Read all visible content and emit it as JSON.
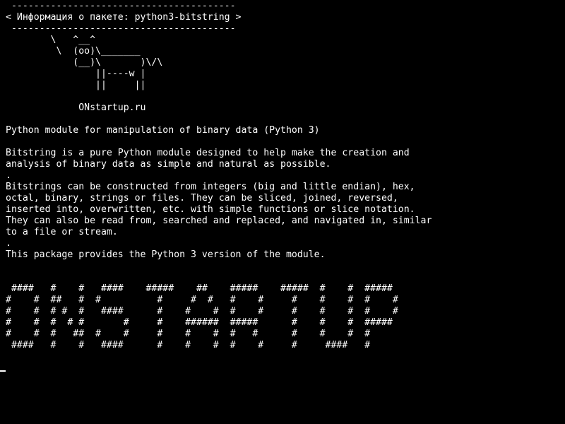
{
  "theme": {
    "background": "#000000",
    "foreground": "#ffffff"
  },
  "terminal": {
    "lines": [
      " ----------------------------------------",
      "< Информация о пакете: python3-bitstring >",
      " ----------------------------------------",
      "        \\   ^__^",
      "         \\  (oo)\\_______",
      "            (__)\\       )\\/\\",
      "                ||----w |",
      "                ||     ||",
      "",
      "             ONstartup.ru",
      "",
      "Python module for manipulation of binary data (Python 3)",
      "",
      "Bitstring is a pure Python module designed to help make the creation and",
      "analysis of binary data as simple and natural as possible.",
      ".",
      "Bitstrings can be constructed from integers (big and little endian), hex,",
      "octal, binary, strings or files. They can be sliced, joined, reversed,",
      "inserted into, overwritten, etc. with simple functions or slice notation.",
      "They can also be read from, searched and replaced, and navigated in, similar",
      "to a file or stream.",
      ".",
      "This package provides the Python 3 version of the module.",
      "",
      "",
      " ####   #    #   ####    #####    ##    #####    #####  #    #  #####",
      "#    #  ##   #  #          #     #  #   #    #     #    #    #  #    #",
      "#    #  # #  #   ####      #    #    #  #    #     #    #    #  #    #",
      "#    #  #  # #       #     #    ######  #####      #    #    #  #####",
      "#    #  #   ##  #    #     #    #    #  #   #      #    #    #  #",
      " ####   #    #   ####      #    #    #  #    #     #     ####   #"
    ]
  }
}
